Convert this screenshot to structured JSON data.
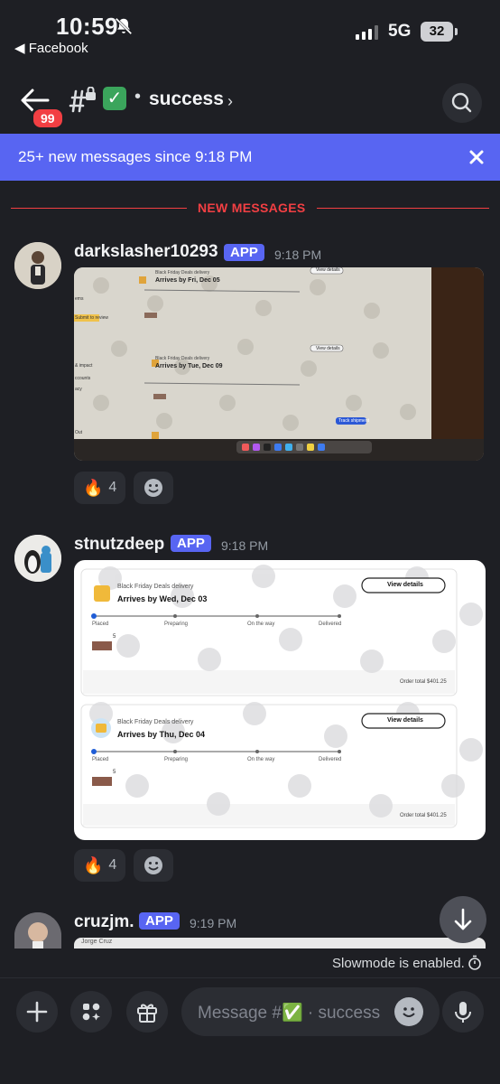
{
  "status_bar": {
    "time": "10:59",
    "back_app": "◀ Facebook",
    "network": "5G",
    "battery": "32"
  },
  "header": {
    "unread_badge": "99",
    "channel_emoji": "✓",
    "channel_dot": "•",
    "channel_name": "success",
    "chevron": "›",
    "icons": [
      "back-arrow-icon",
      "hash-lock-icon",
      "search-icon"
    ]
  },
  "banner": {
    "text": "25+ new messages since 9:18 PM",
    "close_icon": "close-icon"
  },
  "divider": {
    "label": "NEW MESSAGES"
  },
  "messages": [
    {
      "username": "darkslasher10293",
      "tag": "APP",
      "timestamp": "9:18 PM",
      "reaction": {
        "emoji": "🔥",
        "count": "4"
      },
      "photo": {
        "delivery_1_title": "Black Friday Deals delivery",
        "delivery_1_arrives": "Arrives by Fri, Dec 05",
        "delivery_2_title": "Black Friday Deals delivery",
        "delivery_2_arrives": "Arrives by Tue, Dec 09",
        "view_details": "View details",
        "track_shipment": "Track shipment",
        "side_label": "Submit to review",
        "side_items": [
          "ems",
          "& impact",
          "ccounts",
          "acy",
          "Out"
        ]
      }
    },
    {
      "username": "stnutzdeep",
      "tag": "APP",
      "timestamp": "9:18 PM",
      "reaction": {
        "emoji": "🔥",
        "count": "4"
      },
      "deliveries": [
        {
          "title": "Black Friday Deals delivery",
          "arrives": "Arrives by Wed, Dec 03",
          "button": "View details",
          "steps": [
            "Placed",
            "Preparing",
            "On the way",
            "Delivered"
          ],
          "qty": "5",
          "order_total": "Order total $401.25",
          "progress": 0
        },
        {
          "title": "Black Friday Deals delivery",
          "arrives": "Arrives by Thu, Dec 04",
          "button": "View details",
          "steps": [
            "Placed",
            "Preparing",
            "On the way",
            "Delivered"
          ],
          "qty": "5",
          "order_total": "Order total $401.25",
          "progress": 0
        }
      ]
    },
    {
      "username": "cruzjm.",
      "tag": "APP",
      "timestamp": "9:19 PM",
      "image_caption": "Jorge Cruz"
    }
  ],
  "slowmode": {
    "text": "Slowmode is enabled."
  },
  "composer": {
    "placeholder": "Message #✅ · success",
    "buttons": [
      "plus-icon",
      "apps-icon",
      "gift-icon",
      "emoji-icon",
      "mic-icon"
    ]
  },
  "colors": {
    "background": "#1e1f24",
    "accent": "#5865f2",
    "danger": "#f23f43",
    "surface": "#2b2d33"
  }
}
